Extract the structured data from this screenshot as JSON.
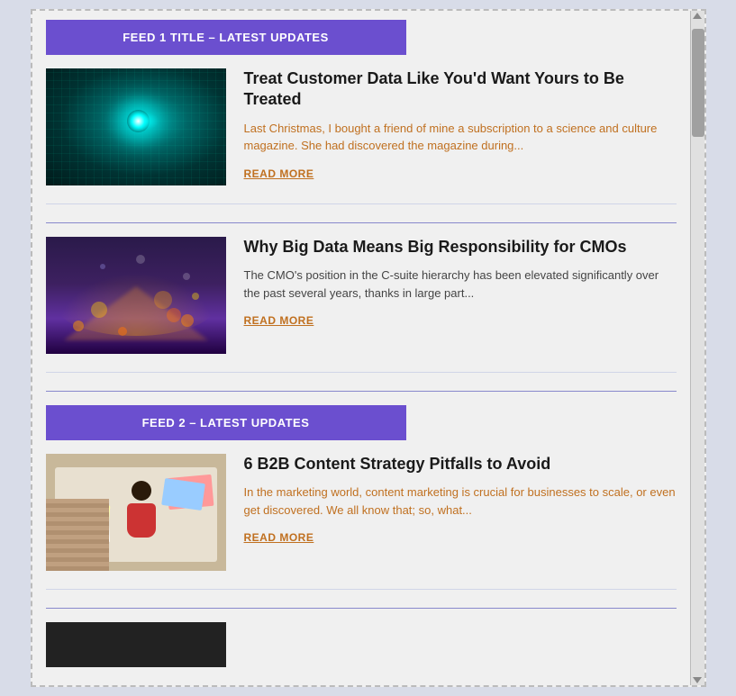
{
  "feeds": [
    {
      "id": "feed1",
      "header": "FEED 1 TITLE – LATEST UPDATES",
      "articles": [
        {
          "id": "article1",
          "title": "Treat Customer Data Like You'd Want Yours to Be Treated",
          "excerpt": "Last Christmas, I bought a friend of mine a subscription to a science and culture magazine. She had discovered the magazine during...",
          "read_more": "READ MORE",
          "image_type": "matrix"
        },
        {
          "id": "article2",
          "title": "Why Big Data Means Big Responsibility for CMOs",
          "excerpt": "The CMO's position in the C-suite hierarchy has been elevated significantly over the past several years, thanks in large part...",
          "read_more": "READ MORE",
          "image_type": "bigdata"
        }
      ]
    },
    {
      "id": "feed2",
      "header": "FEED 2 – LATEST UPDATES",
      "articles": [
        {
          "id": "article3",
          "title": "6 B2B Content Strategy Pitfalls to Avoid",
          "excerpt": "In the marketing world, content marketing is crucial for businesses to scale, or even get discovered. We all know that; so, what...",
          "read_more": "READ MORE",
          "image_type": "topdown"
        }
      ]
    }
  ]
}
